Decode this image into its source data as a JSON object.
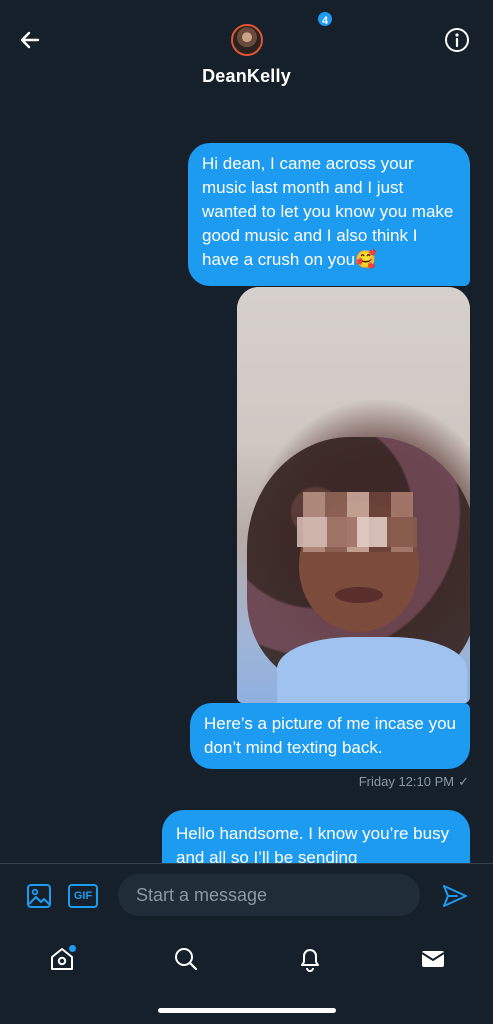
{
  "header": {
    "contact_name": "DeanKelly",
    "back_icon": "arrow-left-icon",
    "info_icon": "info-circle-icon"
  },
  "messages": [
    {
      "type": "text",
      "direction": "sent",
      "text": "Hi dean, I came across your music last month and I just wanted to let you know you make good music and I also think I have a crush on you🥰"
    },
    {
      "type": "image",
      "direction": "sent",
      "description_icon": "photo-attachment"
    },
    {
      "type": "text",
      "direction": "sent",
      "text": "Here’s a picture of me incase you don’t mind texting back."
    },
    {
      "type": "text",
      "direction": "sent",
      "text": "Hello handsome. I know you’re busy and all so I’ll be sending"
    }
  ],
  "timestamp": {
    "label": "Friday 12:10 PM",
    "check": "✓"
  },
  "composer": {
    "placeholder": "Start a message",
    "gif_label": "GIF",
    "media_icon": "image-icon",
    "send_icon": "send-icon"
  },
  "bottom_nav": {
    "notification_count": "4",
    "items": [
      "home-icon",
      "search-icon",
      "bell-icon",
      "mail-icon"
    ]
  },
  "colors": {
    "background": "#15202b",
    "accent": "#1d9bf0",
    "muted_text": "#8b98a5"
  }
}
